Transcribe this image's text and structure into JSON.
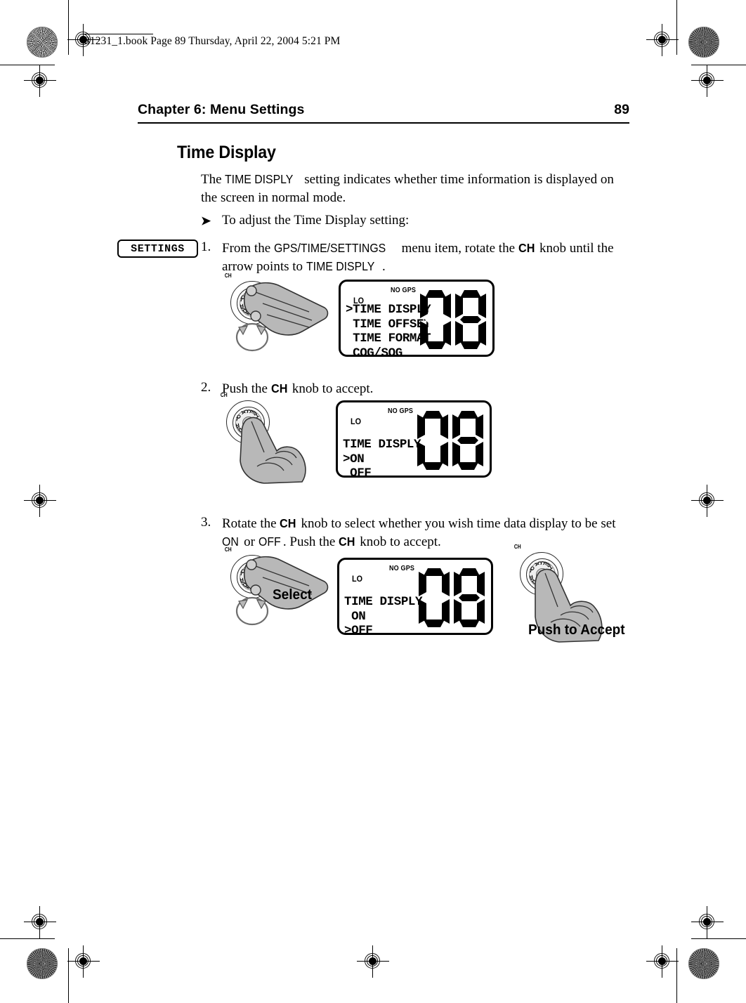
{
  "print_marks": {
    "file_stamp": "81231_1.book  Page 89  Thursday, April 22, 2004  5:21 PM"
  },
  "header": {
    "chapter": "Chapter 6: Menu Settings",
    "page_number": "89"
  },
  "section": {
    "title": "Time Display",
    "intro_before": "The ",
    "intro_term": "TIME DISPLY",
    "intro_after": " setting indicates whether time information is displayed on the screen in normal mode.",
    "task_arrow": "➤",
    "task_label": "To adjust the Time Display setting:"
  },
  "settings_tag": "SETTINGS",
  "steps": [
    {
      "number": "1.",
      "text_parts": [
        "From the ",
        "GPS/TIME/SETTINGS",
        " menu item, rotate the ",
        "CH",
        " knob until the arrow points to ",
        "TIME DISPLY",
        "."
      ]
    },
    {
      "number": "2.",
      "text_parts": [
        "Push the ",
        "CH",
        " knob to accept."
      ]
    },
    {
      "number": "3.",
      "text_parts": [
        "Rotate the ",
        "CH",
        " knob to select whether you wish time data display to be set ",
        "ON",
        " or ",
        "OFF",
        ". Push the ",
        "CH",
        " knob to accept."
      ]
    }
  ],
  "knob": {
    "label": "CH",
    "ring_text": "PUSH TO ACCEPT",
    "select_caption": "Select",
    "push_caption": "Push to Accept"
  },
  "lcds": [
    {
      "status_gps": "NO GPS",
      "status_power": "LO",
      "lines": [
        ">TIME DISPLY",
        " TIME OFFSET",
        " TIME FORMAT",
        " COG/SOG"
      ],
      "channel": "08",
      "digits": [
        "0",
        "8"
      ]
    },
    {
      "status_gps": "NO GPS",
      "status_power": "LO",
      "lines": [
        "TIME DISPLY",
        ">ON",
        " OFF"
      ],
      "channel": "08",
      "digits": [
        "0",
        "8"
      ]
    },
    {
      "status_gps": "NO GPS",
      "status_power": "LO",
      "lines": [
        "TIME DISPLY",
        " ON",
        ">OFF"
      ],
      "channel": "08",
      "digits": [
        "0",
        "8"
      ]
    }
  ],
  "colors": {
    "ink": "#000000",
    "paper": "#ffffff",
    "hand_fill": "#b8b8b8"
  }
}
